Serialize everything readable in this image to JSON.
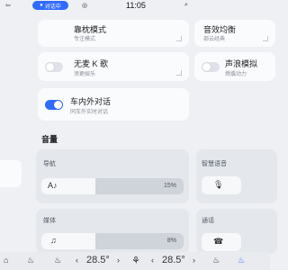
{
  "status": {
    "left_glyph": "⇦",
    "call_pill": "对话中",
    "time": "11:05",
    "loop_icon": "◎",
    "mic_icon": "⌕"
  },
  "cards": {
    "pillow": {
      "title": "靠枕模式",
      "sub": "专注模式"
    },
    "eq": {
      "title": "音效均衡",
      "sub": "部云经典"
    },
    "karaoke": {
      "title": "无麦 K 歌",
      "sub": "添更娱乐",
      "toggle_on": false
    },
    "wave": {
      "title": "声浪模拟",
      "sub": "燃撬动力",
      "toggle_on": false
    },
    "intercom": {
      "title": "车内外对话",
      "sub": "同车外实时对话",
      "toggle_on": true
    }
  },
  "volume": {
    "section_title": "音量",
    "nav": {
      "label": "导航",
      "value_text": "15%",
      "level": 0.15,
      "icon": "A♪"
    },
    "assistant": {
      "label": "智慧语音",
      "icon": "🎙"
    },
    "media": {
      "label": "媒体",
      "value_text": "8%",
      "level": 0.08,
      "icon": "♫"
    },
    "call": {
      "label": "通话",
      "icon": "☎"
    }
  },
  "dock": {
    "home_icon": "⌂",
    "seat_icon": "♨",
    "fan_icon": "⚘",
    "temp_left": "28.5°",
    "temp_right": "28.5°",
    "down_chevron": "‹",
    "up_chevron": "›"
  }
}
